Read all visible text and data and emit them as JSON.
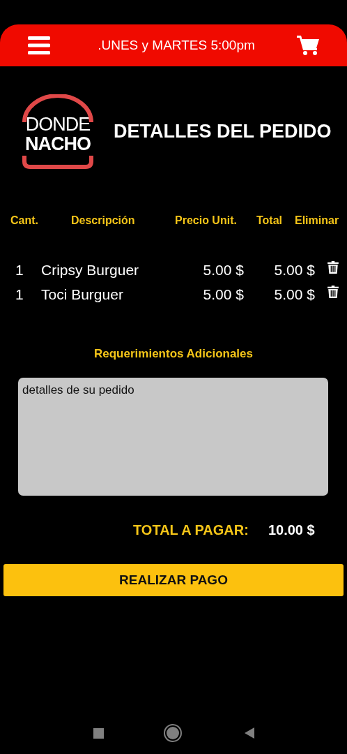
{
  "top_bar": {
    "title": ".UNES y MARTES 5:00pm"
  },
  "logo": {
    "line_1": "DONDE",
    "line_2": "NACHO"
  },
  "page_title": "DETALLES DEL PEDIDO",
  "table": {
    "columns": [
      "Cant.",
      "Descripción",
      "Precio Unit.",
      "Total",
      "Eliminar"
    ],
    "rows": [
      {
        "qty": "1",
        "description": "Cripsy Burguer",
        "unit_price": "5.00 $",
        "total": "5.00 $"
      },
      {
        "qty": "1",
        "description": "Toci Burguer",
        "unit_price": "5.00 $",
        "total": "5.00 $"
      }
    ]
  },
  "notes": {
    "label": "Requerimientos Adicionales",
    "placeholder": "detalles de su pedido"
  },
  "total": {
    "label": "TOTAL A PAGAR:",
    "value": "10.00 $"
  },
  "pay_button": "REALIZAR PAGO"
}
